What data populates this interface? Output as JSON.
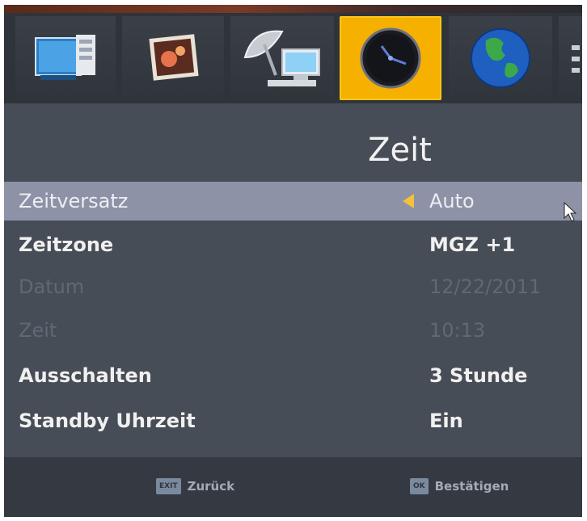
{
  "menu_icons": [
    {
      "name": "picture-settings-icon",
      "active": false
    },
    {
      "name": "media-photo-icon",
      "active": false
    },
    {
      "name": "satellite-dish-icon",
      "active": false
    },
    {
      "name": "clock-icon",
      "active": true
    },
    {
      "name": "globe-icon",
      "active": false
    },
    {
      "name": "more-icon",
      "active": false
    }
  ],
  "page_title": "Zeit",
  "settings": [
    {
      "label": "Zeitversatz",
      "value": "Auto",
      "state": "selected"
    },
    {
      "label": "Zeitzone",
      "value": "MGZ +1",
      "state": "normal"
    },
    {
      "label": "Datum",
      "value": "12/22/2011",
      "state": "disabled"
    },
    {
      "label": "Zeit",
      "value": "10:13",
      "state": "disabled"
    },
    {
      "label": "Ausschalten",
      "value": "3 Stunde",
      "state": "normal"
    },
    {
      "label": "Standby Uhrzeit",
      "value": "Ein",
      "state": "normal"
    }
  ],
  "footer": {
    "back_key": "EXIT",
    "back_label": "Zurück",
    "ok_key": "OK",
    "ok_label": "Bestätigen"
  },
  "colors": {
    "active_tile": "#f5b000",
    "selected_row": "#8e92a6",
    "panel": "#474d56"
  }
}
